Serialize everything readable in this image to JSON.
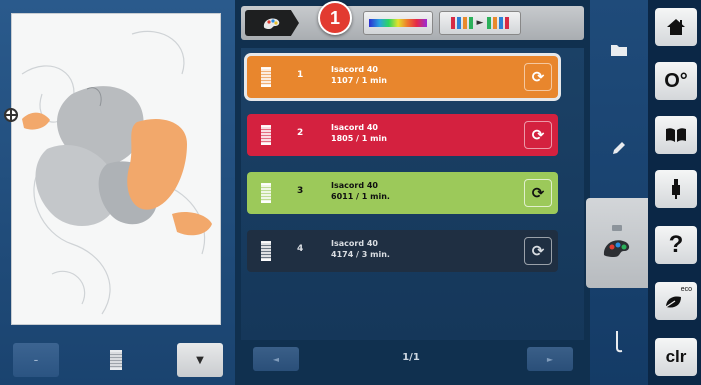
{
  "header": {
    "callout_badge": "1",
    "color_bar_icon": "thread-color-bar-icon",
    "sort_icon": "color-sort-icon"
  },
  "threads": [
    {
      "number": "1",
      "name": "Isacord 40",
      "info": "1107 / 1 min",
      "bg": "#e8862d",
      "text": "#ffffff",
      "selected": true
    },
    {
      "number": "2",
      "name": "Isacord 40",
      "info": "1805 / 1 min",
      "bg": "#d4213f",
      "text": "#ffffff",
      "selected": false
    },
    {
      "number": "3",
      "name": "Isacord 40",
      "info": "6011 / 1 min.",
      "bg": "#9cc95a",
      "text": "#101010",
      "selected": false
    },
    {
      "number": "4",
      "name": "Isacord 40",
      "info": "4174 / 3 min.",
      "bg": "#1f2f42",
      "text": "#d9dde2",
      "selected": false
    }
  ],
  "pager": {
    "label": "1/1",
    "prev_icon": "chevron-left-icon",
    "next_icon": "chevron-right-icon"
  },
  "preview_controls": {
    "left_icon": "minus-icon",
    "right_icon": "chevron-down-icon"
  },
  "right_buttons": [
    {
      "icon": "home-icon",
      "text": ""
    },
    {
      "icon": "settings-icon",
      "text": "O°"
    },
    {
      "icon": "tutorial-book-icon",
      "text": ""
    },
    {
      "icon": "presser-foot-icon",
      "text": ""
    },
    {
      "icon": "help-icon",
      "text": "?"
    },
    {
      "icon": "eco-icon",
      "text": "eco"
    },
    {
      "icon": "clear-icon",
      "text": "clr"
    }
  ],
  "colors": {
    "panel_bg": "#143a63",
    "accent_orange": "#e8862d",
    "callout_red": "#e23b30"
  }
}
